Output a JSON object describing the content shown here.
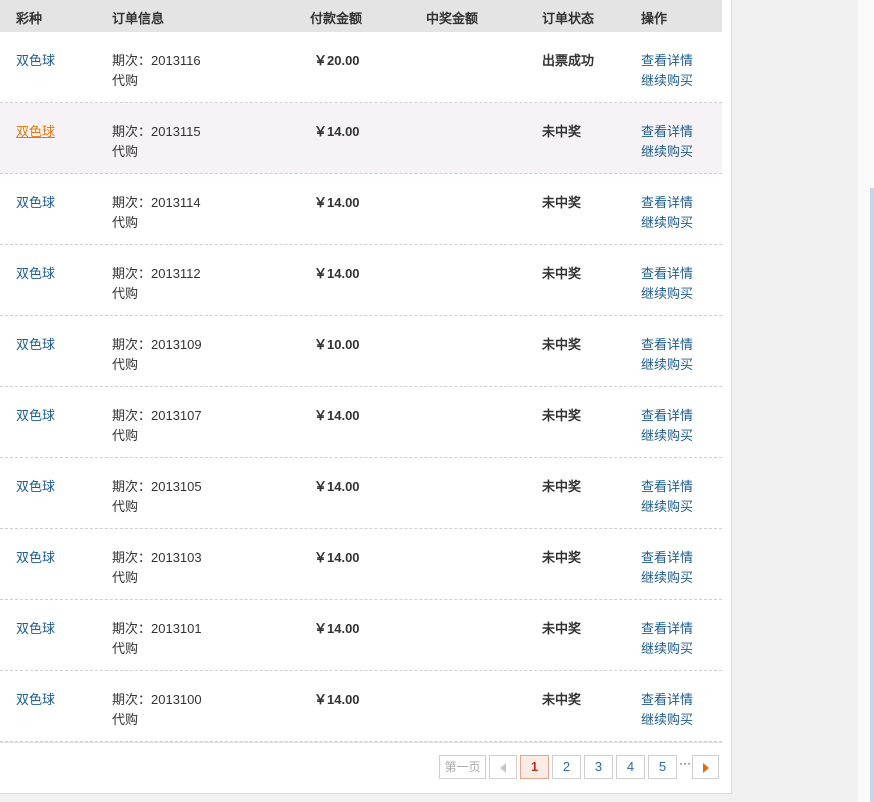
{
  "table": {
    "headers": {
      "type": "彩种",
      "info": "订单信息",
      "pay": "付款金额",
      "win": "中奖金额",
      "status": "订单状态",
      "ops": "操作"
    },
    "rows": [
      {
        "type": "双色球",
        "issue": "期次：2013116",
        "mode": "代购",
        "pay": "￥20.00",
        "win": "",
        "status": "出票成功",
        "op_detail": "查看详情",
        "op_buy": "继续购买"
      },
      {
        "type": "双色球",
        "issue": "期次：2013115",
        "mode": "代购",
        "pay": "￥14.00",
        "win": "",
        "status": "未中奖",
        "op_detail": "查看详情",
        "op_buy": "继续购买"
      },
      {
        "type": "双色球",
        "issue": "期次：2013114",
        "mode": "代购",
        "pay": "￥14.00",
        "win": "",
        "status": "未中奖",
        "op_detail": "查看详情",
        "op_buy": "继续购买"
      },
      {
        "type": "双色球",
        "issue": "期次：2013112",
        "mode": "代购",
        "pay": "￥14.00",
        "win": "",
        "status": "未中奖",
        "op_detail": "查看详情",
        "op_buy": "继续购买"
      },
      {
        "type": "双色球",
        "issue": "期次：2013109",
        "mode": "代购",
        "pay": "￥10.00",
        "win": "",
        "status": "未中奖",
        "op_detail": "查看详情",
        "op_buy": "继续购买"
      },
      {
        "type": "双色球",
        "issue": "期次：2013107",
        "mode": "代购",
        "pay": "￥14.00",
        "win": "",
        "status": "未中奖",
        "op_detail": "查看详情",
        "op_buy": "继续购买"
      },
      {
        "type": "双色球",
        "issue": "期次：2013105",
        "mode": "代购",
        "pay": "￥14.00",
        "win": "",
        "status": "未中奖",
        "op_detail": "查看详情",
        "op_buy": "继续购买"
      },
      {
        "type": "双色球",
        "issue": "期次：2013103",
        "mode": "代购",
        "pay": "￥14.00",
        "win": "",
        "status": "未中奖",
        "op_detail": "查看详情",
        "op_buy": "继续购买"
      },
      {
        "type": "双色球",
        "issue": "期次：2013101",
        "mode": "代购",
        "pay": "￥14.00",
        "win": "",
        "status": "未中奖",
        "op_detail": "查看详情",
        "op_buy": "继续购买"
      },
      {
        "type": "双色球",
        "issue": "期次：2013100",
        "mode": "代购",
        "pay": "￥14.00",
        "win": "",
        "status": "未中奖",
        "op_detail": "查看详情",
        "op_buy": "继续购买"
      }
    ]
  },
  "pager": {
    "first": "第一页",
    "pages": [
      "1",
      "2",
      "3",
      "4",
      "5"
    ],
    "current": "1",
    "ellipsis": "···",
    "prev_icon": "triangle-left-icon",
    "next_icon": "triangle-right-icon"
  },
  "colors": {
    "link": "#1d5c8c",
    "link_hover": "#e07a10",
    "highlight_row": "#f7f2f5",
    "header_bg": "#e4e4e4",
    "current_page": "#c0321a"
  }
}
